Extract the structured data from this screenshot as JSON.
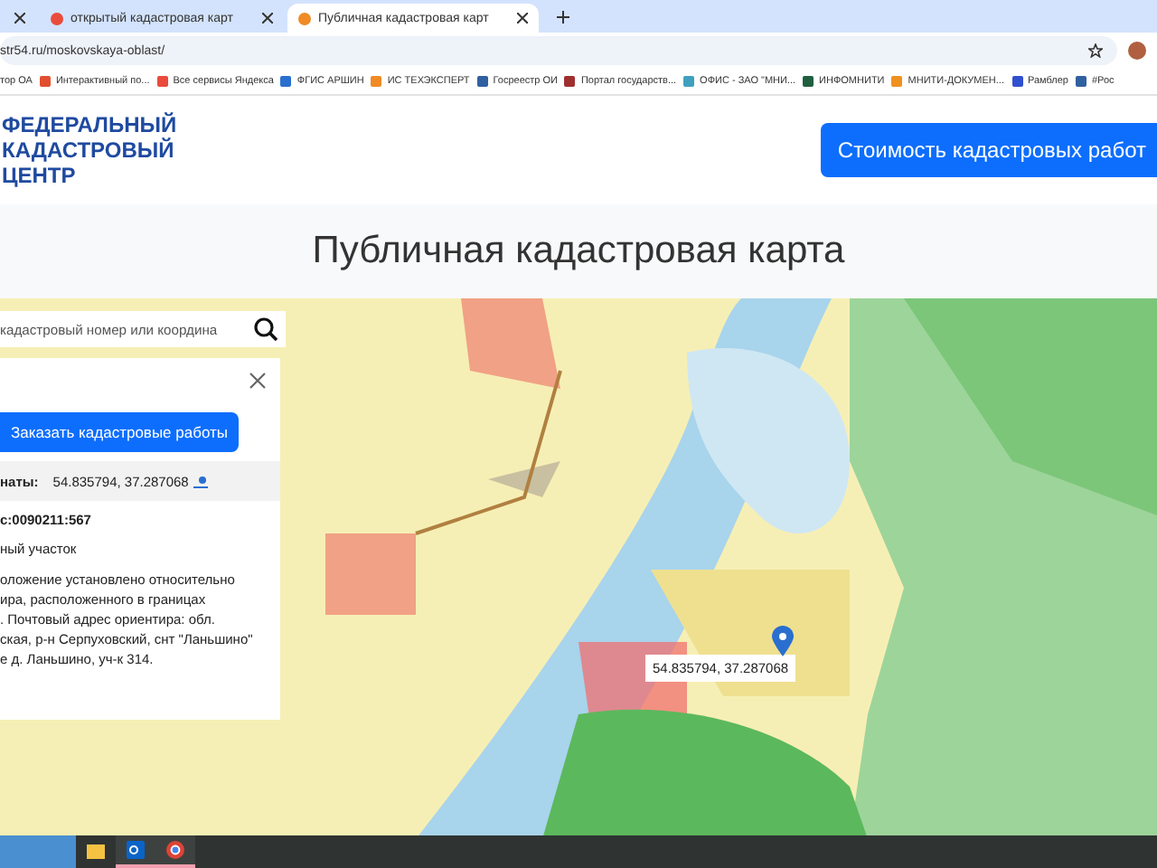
{
  "browser": {
    "tabs": [
      {
        "selected": false
      },
      {
        "title": "открытый кадастровая карт",
        "selected": false
      },
      {
        "title": "Публичная кадастровая карт",
        "selected": true
      }
    ],
    "address": "str54.ru/moskovskaya-oblast/",
    "bookmarks": [
      "тор ОА",
      "Интерактивный по...",
      "Все сервисы Яндекса",
      "ФГИС АРШИН",
      "ИС ТЕХЭКСПЕРТ",
      "Госреестр ОИ",
      "Портал государств...",
      "ОФИС - ЗАО \"МНИ...",
      "ИНФОМНИТИ",
      "МНИТИ-ДОКУМЕН...",
      "Рамблер",
      "#Рос"
    ]
  },
  "header": {
    "logo_lines": [
      "ФЕДЕРАЛЬНЫЙ",
      "КАДАСТРОВЫЙ",
      "ЦЕНТР"
    ],
    "cta": "Стоимость кадастровых работ"
  },
  "page_title": "Публичная кадастровая карта",
  "search": {
    "placeholder": "кадастровый номер или координа"
  },
  "panel": {
    "order_button": "Заказать кадастровые работы",
    "coords_label": "наты:",
    "coords_value": "54.835794, 37.287068",
    "cad_number": "с:0090211:567",
    "type": "ный участок",
    "description": [
      "оложение установлено относительно",
      "ира, расположенного в границах",
      ". Почтовый адрес ориентира: обл.",
      "ская, р-н Серпуховский, снт \"Ланьшино\"",
      "е д. Ланьшино, уч-к 314."
    ]
  },
  "map": {
    "marker_label": "54.835794, 37.287068"
  },
  "taskbar": {
    "apps": [
      {
        "kind": "files",
        "selected": false
      },
      {
        "kind": "mail",
        "selected": true
      },
      {
        "kind": "browser",
        "selected": true
      }
    ]
  }
}
